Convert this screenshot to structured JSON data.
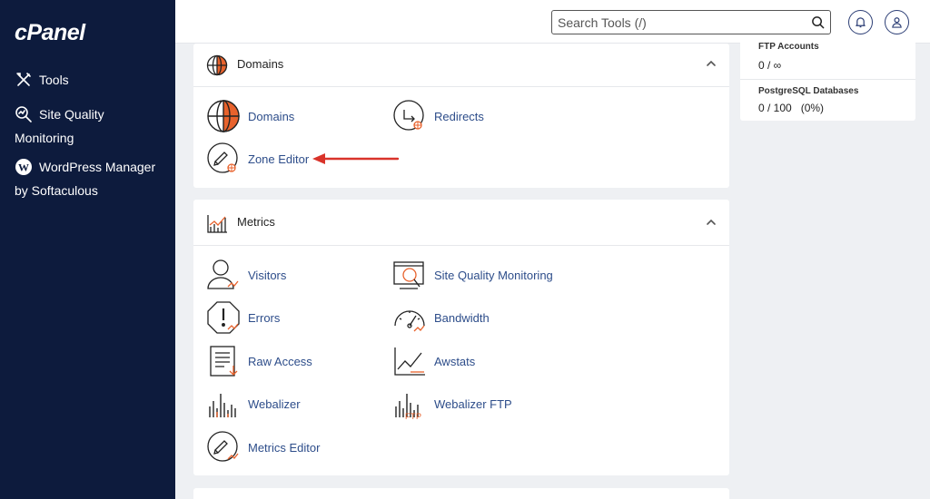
{
  "sidebar": {
    "logo": "cPanel",
    "items": [
      {
        "icon": "tools-icon",
        "label": "Tools"
      },
      {
        "icon": "site-quality-icon",
        "label": "Site Quality",
        "label2": "Monitoring"
      },
      {
        "icon": "wordpress-icon",
        "label": "WordPress Manager",
        "label2": "by Softaculous"
      }
    ]
  },
  "topbar": {
    "search_placeholder": "Search Tools (/)"
  },
  "stats": [
    {
      "label": "FTP Accounts",
      "value": "0 / ∞"
    },
    {
      "label": "PostgreSQL Databases",
      "value": "0 / 100   (0%)"
    }
  ],
  "domains_panel": {
    "title": "Domains",
    "tools": [
      {
        "icon": "domains-globe-icon",
        "label": "Domains"
      },
      {
        "icon": "redirects-icon",
        "label": "Redirects"
      },
      {
        "icon": "zone-editor-icon",
        "label": "Zone Editor"
      }
    ]
  },
  "metrics_panel": {
    "title": "Metrics",
    "tools": [
      {
        "icon": "visitors-icon",
        "label": "Visitors"
      },
      {
        "icon": "site-quality-monitoring-icon",
        "label": "Site Quality Monitoring"
      },
      {
        "icon": "errors-icon",
        "label": "Errors"
      },
      {
        "icon": "bandwidth-icon",
        "label": "Bandwidth"
      },
      {
        "icon": "raw-access-icon",
        "label": "Raw Access"
      },
      {
        "icon": "awstats-icon",
        "label": "Awstats"
      },
      {
        "icon": "webalizer-icon",
        "label": "Webalizer"
      },
      {
        "icon": "webalizer-ftp-icon",
        "label": "Webalizer FTP",
        "icon_text": "FTP"
      },
      {
        "icon": "metrics-editor-icon",
        "label": "Metrics Editor"
      }
    ]
  },
  "colors": {
    "sidebar_bg": "#0d1b3d",
    "link": "#2d4d8a",
    "accent_orange": "#e8622c",
    "arrow_red": "#d9332a"
  }
}
